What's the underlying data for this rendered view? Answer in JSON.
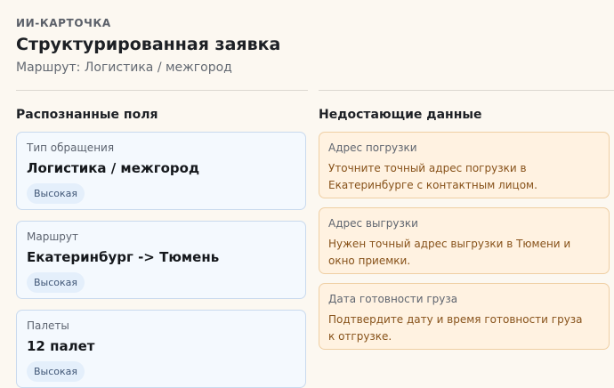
{
  "header": {
    "eyebrow": "ИИ-КАРТОЧКА",
    "title": "Структурированная заявка",
    "subtitle": "Маршрут: Логистика / межгород"
  },
  "recognized": {
    "title": "Распознанные поля",
    "fields": [
      {
        "label": "Тип обращения",
        "value": "Логистика / межгород",
        "confidence": "Высокая"
      },
      {
        "label": "Маршрут",
        "value": "Екатеринбург -> Тюмень",
        "confidence": "Высокая"
      },
      {
        "label": "Палеты",
        "value": "12 палет",
        "confidence": "Высокая"
      }
    ]
  },
  "missing": {
    "title": "Недостающие данные",
    "items": [
      {
        "label": "Адрес погрузки",
        "text": "Уточните точный адрес погрузки в Екатеринбурге с контактным лицом."
      },
      {
        "label": "Адрес выгрузки",
        "text": "Нужен точный адрес выгрузки в Тюмени и окно приемки."
      },
      {
        "label": "Дата готовности груза",
        "text": "Подтвердите дату и время готовности груза к отгрузке."
      }
    ]
  },
  "colors": {
    "page_background": "#fcf8f1",
    "recognized_card_background": "#f4f9fe",
    "recognized_card_border": "#c9daee",
    "badge_background": "#e4effb",
    "missing_card_background": "#fff2e1",
    "missing_card_border": "#efcfa4",
    "missing_text": "#87521a"
  }
}
